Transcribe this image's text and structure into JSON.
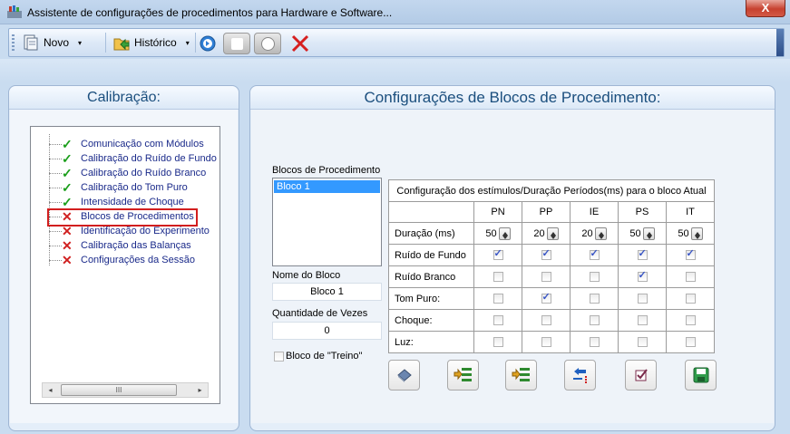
{
  "window": {
    "title": "Assistente de configurações de procedimentos para Hardware e Software...",
    "close_label": "X"
  },
  "toolbar": {
    "novo_label": "Novo",
    "historico_label": "Histórico",
    "dropdown_arrow": "▾"
  },
  "left_panel": {
    "title": "Calibração:",
    "items": [
      {
        "label": "Comunicação com Módulos",
        "status": "done"
      },
      {
        "label": "Calibração do Ruído de Fundo",
        "status": "done"
      },
      {
        "label": "Calibração do Ruído Branco",
        "status": "done"
      },
      {
        "label": "Calibração do Tom Puro",
        "status": "done"
      },
      {
        "label": "Intensidade de Choque",
        "status": "done"
      },
      {
        "label": "Blocos de Procedimentos",
        "status": "pending",
        "selected": true
      },
      {
        "label": "Identificação do Experimento",
        "status": "pending"
      },
      {
        "label": "Calibração das Balanças",
        "status": "pending"
      },
      {
        "label": "Configurações da Sessão",
        "status": "pending"
      }
    ],
    "mark_done": "✓",
    "mark_pending": "✕",
    "scroll_left": "◂",
    "scroll_right": "▸",
    "scroll_grip": "III"
  },
  "right_panel": {
    "title": "Configurações de Blocos de Procedimento:",
    "blocks_label": "Blocos de Procedimento",
    "blocks_list": [
      "Bloco 1"
    ],
    "nome_label": "Nome do Bloco",
    "nome_value": "Bloco 1",
    "quantidade_label": "Quantidade de Vezes",
    "quantidade_value": "0",
    "treino_label": "Bloco de \"Treino\"",
    "treino_checked": false,
    "grid": {
      "caption": "Configuração dos estímulos/Duração Períodos(ms) para o bloco Atual",
      "columns": [
        "PN",
        "PP",
        "IE",
        "PS",
        "IT"
      ],
      "duracao_label": "Duração (ms)",
      "duracao": [
        "50",
        "20",
        "20",
        "50",
        "50"
      ],
      "rows": [
        {
          "label": "Ruído de Fundo",
          "checks": [
            true,
            true,
            true,
            true,
            true
          ]
        },
        {
          "label": "Ruído Branco",
          "checks": [
            false,
            false,
            false,
            true,
            false
          ]
        },
        {
          "label": "Tom Puro:",
          "checks": [
            false,
            true,
            false,
            false,
            false
          ]
        },
        {
          "label": "Choque:",
          "checks": [
            false,
            false,
            false,
            false,
            false
          ]
        },
        {
          "label": "Luz:",
          "checks": [
            false,
            false,
            false,
            false,
            false
          ]
        }
      ]
    },
    "action_buttons": [
      "eraser-icon",
      "add-row-icon",
      "insert-row-icon",
      "move-left-icon",
      "check-icon",
      "save-icon"
    ]
  },
  "colors": {
    "title_text": "#1b4f7e",
    "selection_outline": "#d21e1e",
    "check_green": "#1b9e1b",
    "cross_red": "#d02020"
  }
}
